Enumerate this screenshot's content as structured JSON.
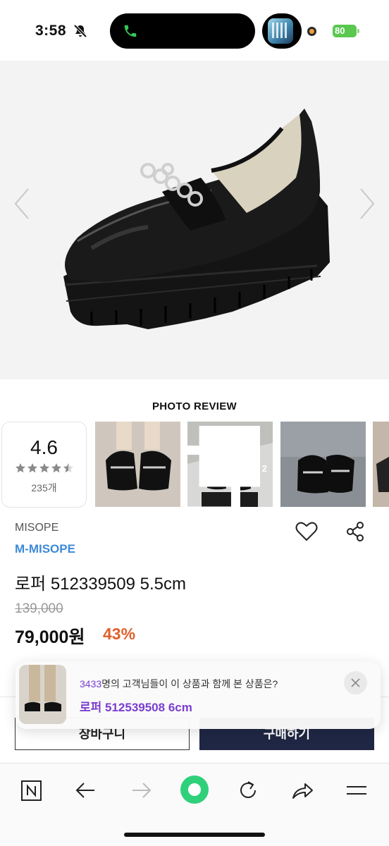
{
  "status_bar": {
    "time": "3:58",
    "battery": "80",
    "colors": {
      "call_green": "#34c759",
      "battery_green": "#5ac84e",
      "recording_orange": "#f0a03a"
    },
    "icons": [
      "bell-slash-icon",
      "phone-icon",
      "app-thumbnail-icon",
      "recording-dot-icon"
    ]
  },
  "hero": {
    "icons": [
      "chevron-left-icon",
      "chevron-right-icon",
      "product-image"
    ]
  },
  "photo_review": {
    "title": "PHOTO REVIEW",
    "rating": "4.6",
    "stars_filled": 4.5,
    "review_count": "235개",
    "thumbnails": [
      {
        "badge": ""
      },
      {
        "badge": "2"
      },
      {
        "badge": ""
      },
      {
        "badge": ""
      }
    ]
  },
  "product": {
    "brand": "MISOPE",
    "store": "M-MISOPE",
    "name": "로퍼 512339509 5.5cm",
    "original_price": "139,000",
    "sale_price": "79,000원",
    "discount": "43%",
    "colors": {
      "store_blue": "#3d8ad8",
      "discount_orange": "#e0612b"
    }
  },
  "actions": {
    "cart_label": "장바구니",
    "buy_label": "구매하기",
    "colors": {
      "buy_bg": "#1f2744"
    }
  },
  "recommendation": {
    "count": "3433",
    "message": "명의 고객님들이 이 상품과 함께 본 상품은?",
    "product_name": "로퍼 512539508 6cm",
    "colors": {
      "accent": "#7a3ed0"
    }
  },
  "browser_bar": {
    "icons": [
      "naver-n-icon",
      "back-arrow-icon",
      "forward-arrow-icon",
      "green-dot-home-icon",
      "refresh-icon",
      "share-arrow-icon",
      "menu-icon"
    ],
    "colors": {
      "home_green": "#2fd07a"
    }
  }
}
